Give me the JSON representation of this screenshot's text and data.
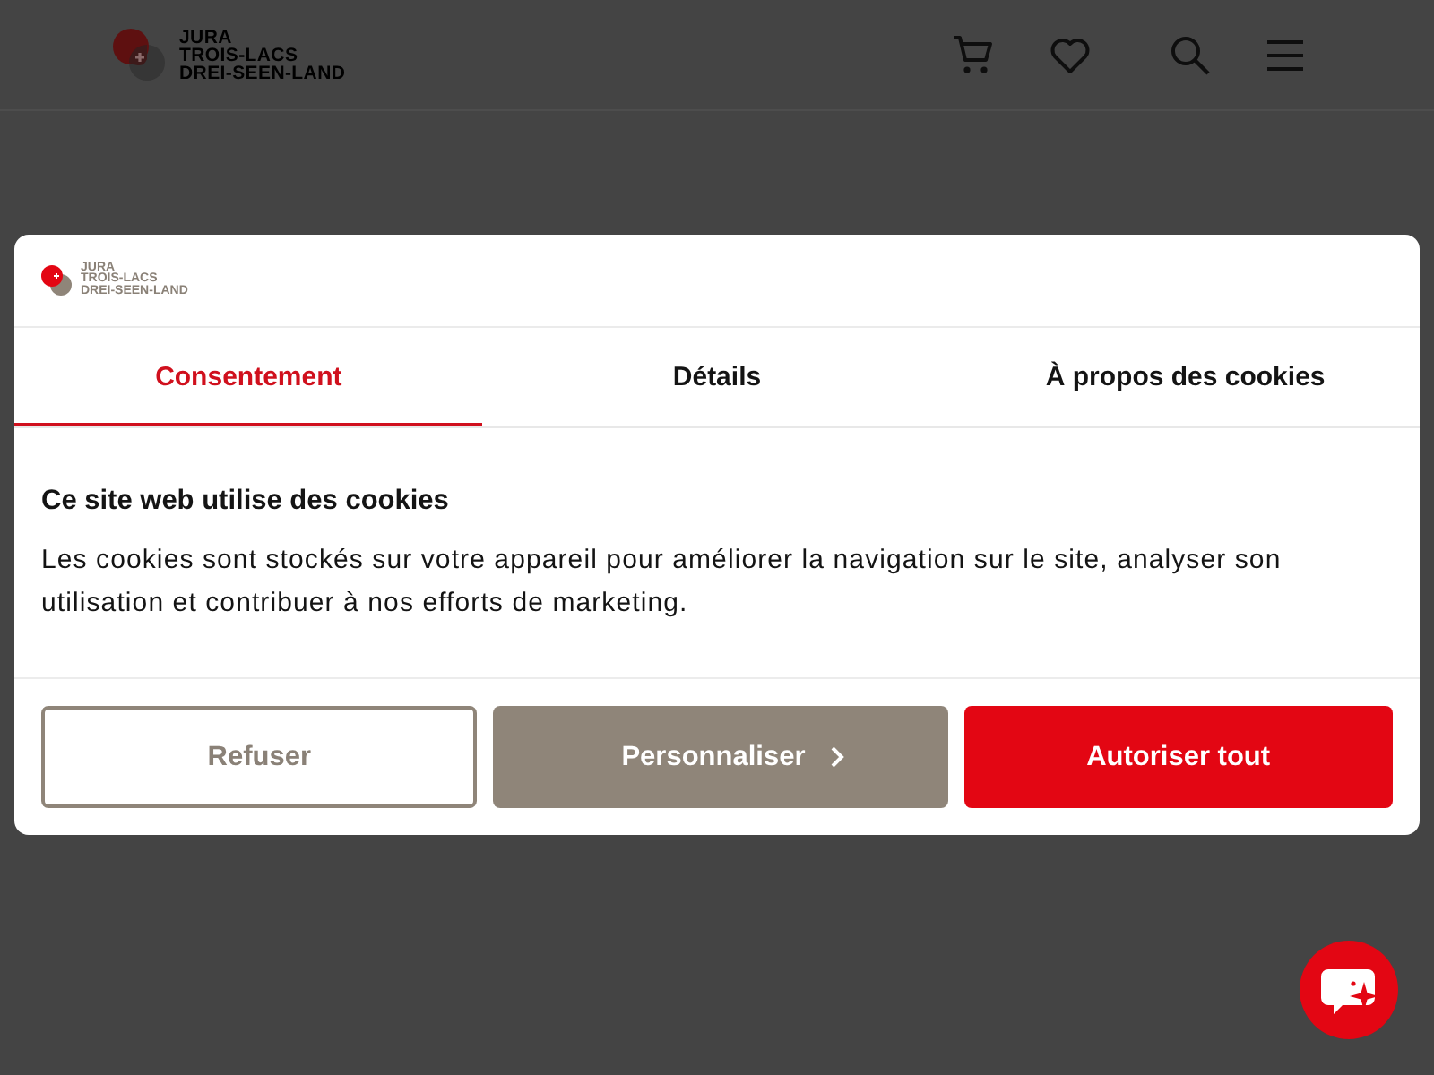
{
  "header": {
    "logo": {
      "lines": [
        "JURA",
        "TROIS-LACS",
        "DREI-SEEN-LAND"
      ]
    }
  },
  "cookie_dialog": {
    "logo": {
      "lines": [
        "JURA",
        "TROIS-LACS",
        "DREI-SEEN-LAND"
      ]
    },
    "tabs": [
      {
        "label": "Consentement",
        "selected": true
      },
      {
        "label": "Détails",
        "selected": false
      },
      {
        "label": "À propos des cookies",
        "selected": false
      }
    ],
    "title": "Ce site web utilise des cookies",
    "text": "Les cookies sont stockés sur votre appareil pour améliorer la navigation sur le site, analyser son utilisation et contribuer à nos efforts de marketing.",
    "buttons": [
      {
        "label": "Refuser",
        "kind": "outline"
      },
      {
        "label": "Personnaliser",
        "kind": "secondary"
      },
      {
        "label": "Autoriser tout",
        "kind": "primary"
      }
    ]
  }
}
